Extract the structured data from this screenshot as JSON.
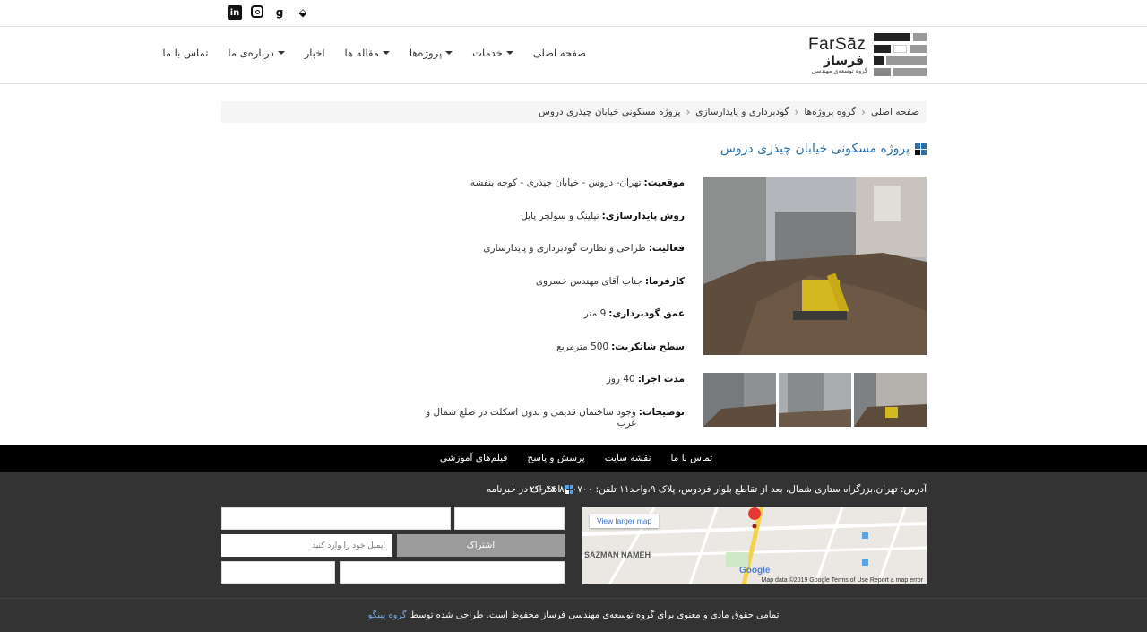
{
  "topbar": {
    "social": [
      {
        "icon": "linkedin-icon",
        "glyph": "in"
      },
      {
        "icon": "instagram-icon",
        "glyph": ""
      },
      {
        "icon": "google-plus-icon",
        "glyph": "g"
      },
      {
        "icon": "foursquare-icon",
        "glyph": "⬙"
      }
    ]
  },
  "header": {
    "logo": {
      "en": "FarSāz",
      "fa": "فرساز",
      "sub": "گروه توسعه‌ی مهندسی"
    },
    "nav": [
      {
        "label": "صفحه اصلی",
        "dropdown": false
      },
      {
        "label": "خدمات",
        "dropdown": true
      },
      {
        "label": "پروژه‌ها",
        "dropdown": true
      },
      {
        "label": "مقاله ها",
        "dropdown": true
      },
      {
        "label": "اخبار",
        "dropdown": false
      },
      {
        "label": "درباره‌ی ما",
        "dropdown": true
      },
      {
        "label": "تماس با ما",
        "dropdown": false
      }
    ]
  },
  "breadcrumb": {
    "items": [
      "صفحه اصلی",
      "گروه پروژه‌ها",
      "گودبرداری و پایدارسازی",
      "پروژه مسکونی خیابان چیذری دروس"
    ]
  },
  "project": {
    "title": "پروژه مسکونی خیابان چیذری دروس",
    "details": [
      {
        "label": "موقعیت:",
        "value": "تهران- دروس - خیابان چیذری - کوچه بنفشه"
      },
      {
        "label": "روش پایدارسازی:",
        "value": "نیلینگ و سولجر پایل"
      },
      {
        "label": "فعالیت:",
        "value": "طراحی و نظارت گودبرداری و پایدارسازی"
      },
      {
        "label": "کارفرما:",
        "value": "جناب آقای مهندس خسروی"
      },
      {
        "label": "عمق گودبرداری:",
        "value": "9 متر"
      },
      {
        "label": "سطح شاتکریت:",
        "value": "500 مترمربع"
      },
      {
        "label": "مدت اجرا:",
        "value": "40 روز"
      },
      {
        "label": "توضیحات:",
        "value": "وجود ساختمان قدیمی و بدون اسکلت در ضلع شمال و غرب"
      }
    ]
  },
  "footer": {
    "links": [
      "تماس با ما",
      "نقشه سایت",
      "پرسش و پاسخ",
      "فیلم‌های آموزشی"
    ],
    "address": "آدرس: تهران،بزرگراه ستاری شمال، بعد از تقاطع بلوار فردوس، پلاک ۹،واحد۱۱  تلفن: ۰۷۰۰ ۸۴ ۴۴ -۰۲۱",
    "newsletter_title": "اشتراک در خبرنامه",
    "email_placeholder": "ایمیل خود را وارد کنید",
    "subscribe_label": "اشتراک",
    "map": {
      "view_larger": "View larger map",
      "footer": "Map data ©2019 Google   Terms of Use   Report a map error",
      "google": "Google",
      "place": "SAZMAN NAMEH"
    },
    "copyright": "تمامی حقوق مادی و معنوی برای گروه توسعه‌ی مهندسی فرساز محفوظ است. طراحی شده توسط",
    "copyright_link": "گروه پینگو"
  }
}
